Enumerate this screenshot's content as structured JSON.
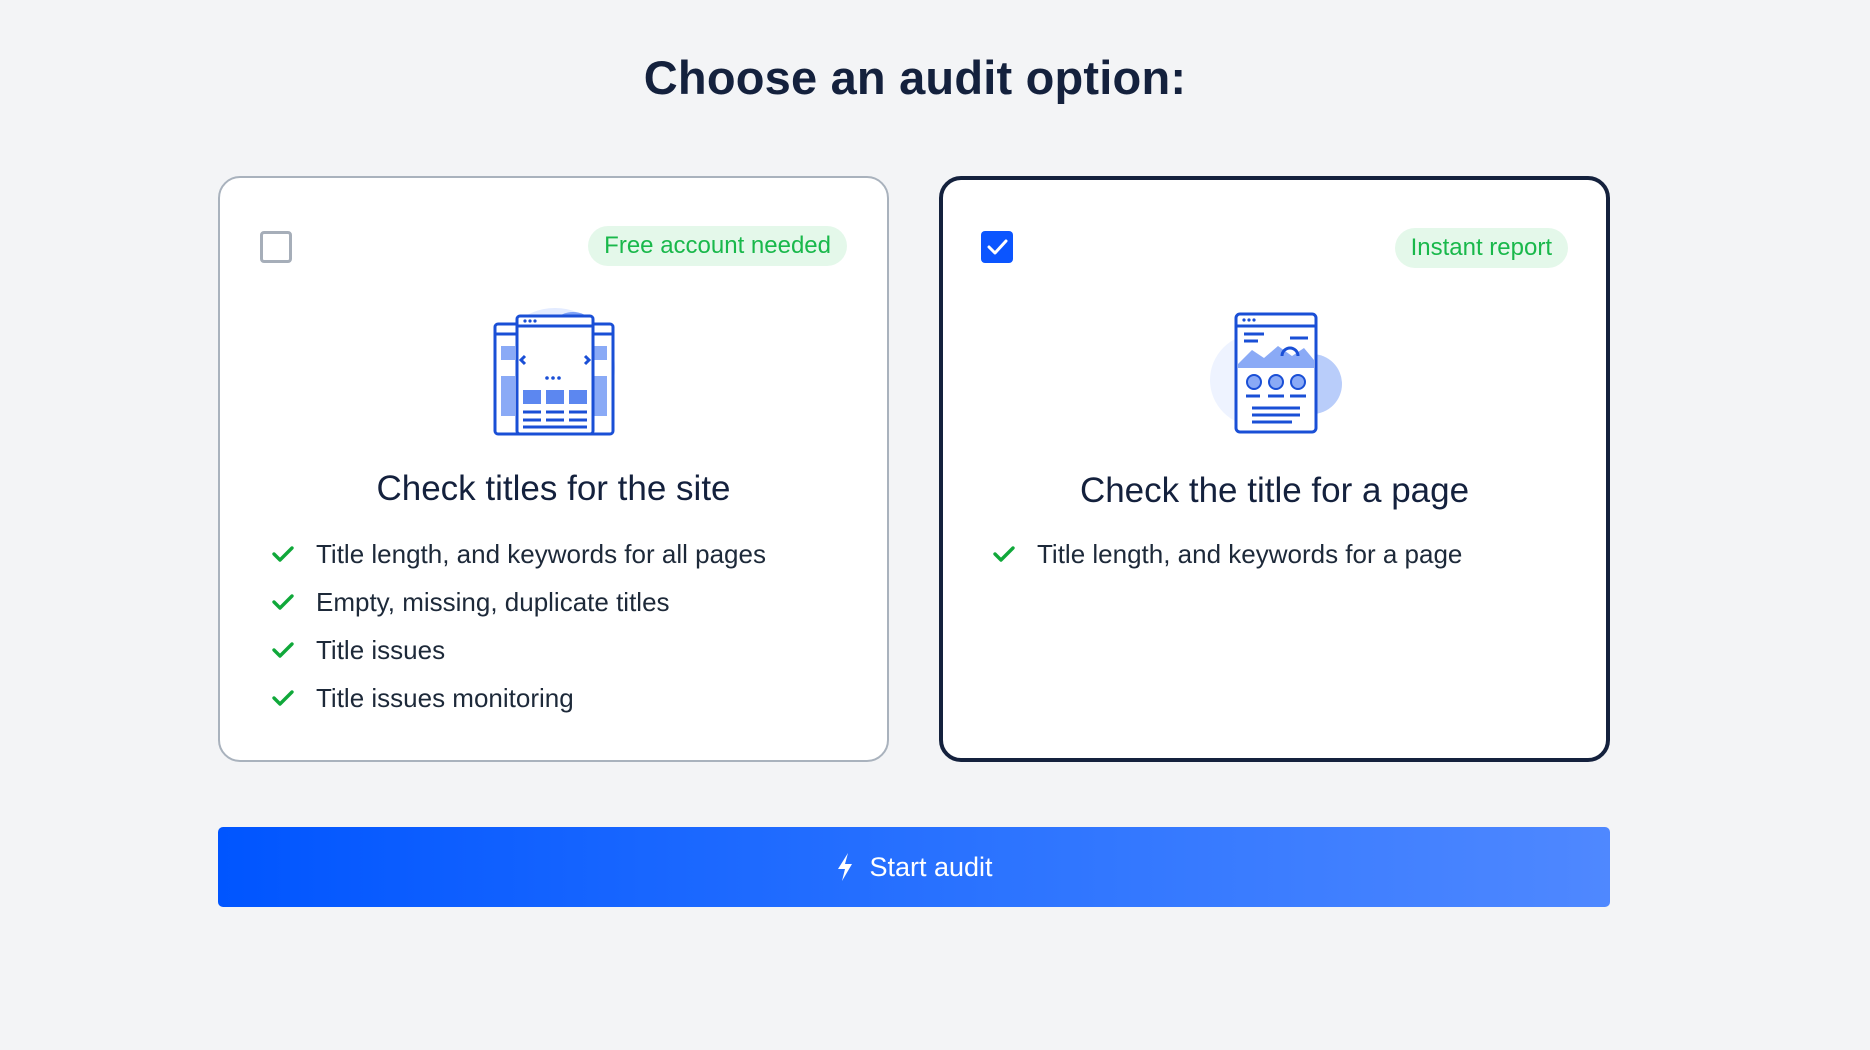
{
  "page": {
    "title": "Choose an audit option:"
  },
  "options": [
    {
      "checked": false,
      "badge": "Free account needed",
      "illustration_icon": "site-pages-illustration",
      "title": "Check titles for the site",
      "features": [
        "Title length, and keywords for all pages",
        "Empty, missing, duplicate titles",
        "Title issues",
        "Title issues monitoring"
      ]
    },
    {
      "checked": true,
      "badge": "Instant report",
      "illustration_icon": "single-page-illustration",
      "title": "Check the title for a page",
      "features": [
        "Title length, and keywords for a page"
      ]
    }
  ],
  "action": {
    "start_label": "Start audit",
    "icon": "lightning-bolt-icon"
  },
  "colors": {
    "accent": "#0b55ff",
    "badge_text": "#19b84b",
    "badge_bg": "#e4f8ea",
    "check": "#10a83a",
    "text_dark": "#14213d"
  }
}
